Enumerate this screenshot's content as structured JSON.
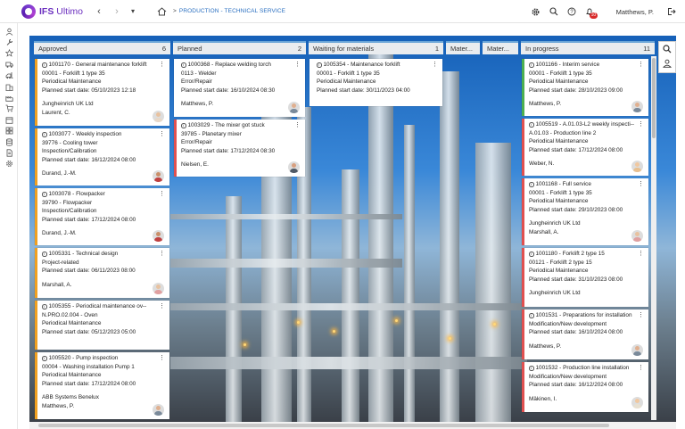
{
  "app": {
    "brand_prefix": "IFS",
    "brand_name": "Ultimo",
    "breadcrumb_sep": ">",
    "breadcrumb": "PRODUCTION - TECHNICAL SERVICE"
  },
  "nav": {
    "back": "‹",
    "forward": "›",
    "menu": "▾"
  },
  "header": {
    "notification_count": "10",
    "user_name": "Matthews, P."
  },
  "colors": {
    "accent": "#6b2fbf",
    "link": "#2a6fc0",
    "orange": "#f0a020",
    "red": "#e05050",
    "green": "#4caf50"
  },
  "columns": [
    {
      "title": "Approved",
      "count": "6"
    },
    {
      "title": "Planned",
      "count": "2"
    },
    {
      "title": "Waiting for materials",
      "count": "1"
    },
    {
      "title": "Mater...",
      "count": ""
    },
    {
      "title": "Mater...",
      "count": ""
    },
    {
      "title": "In progress",
      "count": "11"
    }
  ],
  "cards": {
    "approved": [
      {
        "id": "1001170",
        "title": "General maintenance forklift",
        "line2": "00001 - Forklift 1 type 35",
        "line3": "Periodical Maintenance",
        "date": "Planned start date: 05/10/2023 12:18",
        "extra": "Jungheinrich UK Ltd",
        "person": "Laurent, C."
      },
      {
        "id": "1003077",
        "title": "Weekly inspection",
        "line2": "39776 - Cooling tower",
        "line3": "Inspection/Calibration",
        "date": "Planned start date: 16/12/2024 08:00",
        "person": "Durand, J.-M."
      },
      {
        "id": "1003078",
        "title": "Flowpacker",
        "line2": "39790 - Flowpacker",
        "line3": "Inspection/Calibration",
        "date": "Planned start date: 17/12/2024 08:00",
        "person": "Durand, J.-M."
      },
      {
        "id": "1005331",
        "title": "Technical design",
        "line2": "Project-related",
        "line3": "Planned start date: 06/11/2023 08:00",
        "person": "Marshall, A."
      },
      {
        "id": "1005355",
        "title": "Periodical maintenance ov--",
        "line2": "N.PRO.02.004 - Oven",
        "line3": "Periodical Maintenance",
        "date": "Planned start date: 05/12/2023 05:00"
      },
      {
        "id": "1005520",
        "title": "Pump inspection",
        "line2": "00004 - Washing installation Pump 1",
        "line3": "Periodical Maintenance",
        "date": "Planned start date: 17/12/2024 08:00",
        "extra": "ABB Systems Benelux",
        "person": "Matthews, P."
      }
    ],
    "planned": [
      {
        "id": "1000368",
        "title": "Replace welding torch",
        "line2": "0113 - Welder",
        "line3": "Error/Repair",
        "date": "Planned start date: 16/10/2024 08:30",
        "person": "Matthews, P."
      },
      {
        "id": "1003029",
        "title": "The mixer got stuck",
        "line2": "39785 - Planetary mixer",
        "line3": "Error/Repair",
        "date": "Planned start date: 17/12/2024 08:30",
        "person": "Nielsen, E."
      }
    ],
    "waiting": [
      {
        "id": "1005354",
        "title": "Maintenance forklift",
        "line2": "00001 - Forklift 1 type 35",
        "line3": "Periodical Maintenance",
        "date": "Planned start date: 30/11/2023 04:00"
      }
    ],
    "in_progress": [
      {
        "id": "1001166",
        "title": "Interim service",
        "line2": "00001 - Forklift 1 type 35",
        "line3": "Periodical Maintenance",
        "date": "Planned start date: 28/10/2023 09:00",
        "person": "Matthews, P."
      },
      {
        "id": "1005519",
        "title": "A.01.03-L2 weekly inspecti--",
        "line2": "A.01.03 - Production line 2",
        "line3": "Periodical Maintenance",
        "date": "Planned start date: 17/12/2024 08:00",
        "person": "Weber, N."
      },
      {
        "id": "1001168",
        "title": "Full service",
        "line2": "00001 - Forklift 1 type 35",
        "line3": "Periodical Maintenance",
        "date": "Planned start date: 29/10/2023 08:00",
        "extra": "Jungheinrich UK Ltd",
        "person": "Marshall, A."
      },
      {
        "id": "1001180",
        "title": "Forklift 2 type 15",
        "line2": "00121 - Forklift 2 type 15",
        "line3": "Periodical Maintenance",
        "date": "Planned start date: 31/10/2023 08:00",
        "extra": "Jungheinrich UK Ltd"
      },
      {
        "id": "1001531",
        "title": "Preparations for installation",
        "line2": "Modification/New development",
        "line3": "Planned start date: 16/10/2024 08:00",
        "person": "Matthews, P."
      },
      {
        "id": "1001532",
        "title": "Production line installation",
        "line2": "Modification/New development",
        "line3": "Planned start date: 16/12/2024 08:00",
        "person": "Mäkinen, I."
      }
    ]
  },
  "icons": [
    "home-icon",
    "gear-icon",
    "search-icon",
    "help-icon",
    "bell-icon",
    "logout-icon",
    "info-icon",
    "kebab-icon",
    "avatar-icon",
    "person-icon"
  ]
}
